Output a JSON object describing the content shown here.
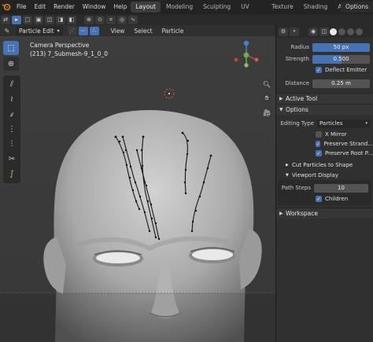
{
  "menubar": {
    "items": [
      "File",
      "Edit",
      "Render",
      "Window",
      "Help"
    ],
    "workspace_tabs": [
      "Layout",
      "Modeling",
      "Sculpting",
      "UV Editing",
      "Texture Paint",
      "Shading",
      "Animation"
    ],
    "active_tab": "Layout",
    "options_label": "Options"
  },
  "viewport_header": {
    "mode": "Particle Edit",
    "menus": [
      "View",
      "Select",
      "Particle"
    ]
  },
  "viewport": {
    "camera_label": "Camera Perspective",
    "object_label": "(213) 7_Submesh-9_1_0_0"
  },
  "properties": {
    "radius_label": "Radius",
    "radius_value": "50 px",
    "strength_label": "Strength",
    "strength_value": "0.500",
    "strength_fraction": 0.5,
    "deflect_emitter_label": "Deflect Emitter",
    "deflect_emitter_checked": true,
    "distance_label": "Distance",
    "distance_value": "0.25 m",
    "active_tool_label": "Active Tool",
    "options_label": "Options",
    "editing_type_label": "Editing Type",
    "editing_type_value": "Particles",
    "x_mirror_label": "X Mirror",
    "preserve_strand_label": "Preserve Strand...",
    "preserve_root_label": "Preserve Root P...",
    "cut_particles_label": "Cut Particles to Shape",
    "viewport_display_label": "Viewport Display",
    "path_steps_label": "Path Steps",
    "path_steps_value": "10",
    "children_label": "Children",
    "workspace_label": "Workspace"
  },
  "colors": {
    "accent": "#4772b3",
    "viewport_bg": "#3d3d3d",
    "panel_bg": "#303030"
  }
}
